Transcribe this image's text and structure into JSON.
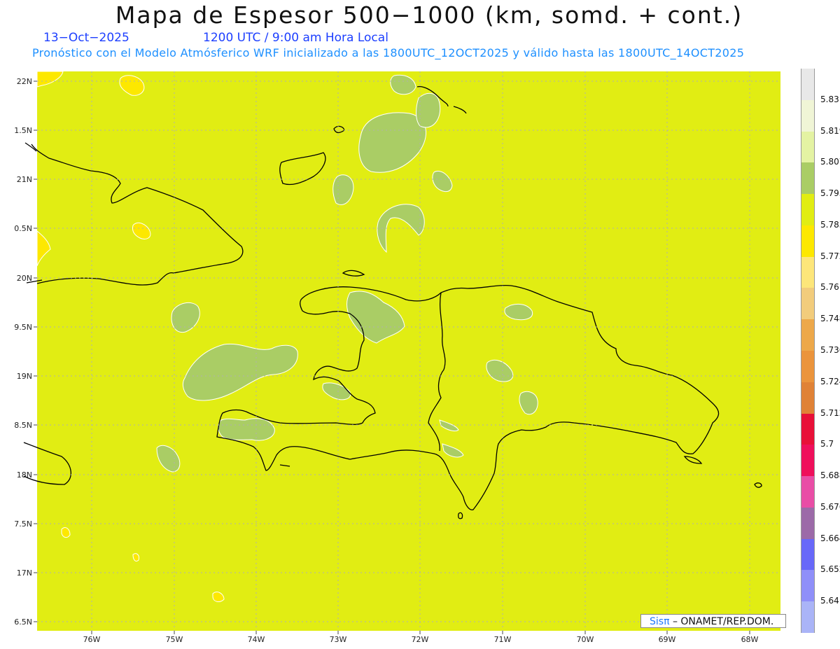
{
  "header": {
    "title": "Mapa de Espesor 500−1000 (km, somd. + cont.)",
    "date": "13−Oct−2025",
    "time": "1200 UTC / 9:00 am Hora Local",
    "forecast": "Pronóstico con el Modelo Atmósferico WRF inicializado a las 1800UTC_12OCT2025 y válido hasta las  1800UTC_14OCT2025"
  },
  "map": {
    "lat_labels": [
      "22N",
      "1.5N",
      "21N",
      "0.5N",
      "20N",
      "9.5N",
      "19N",
      "8.5N",
      "18N",
      "7.5N",
      "17N",
      "6.5N"
    ],
    "lon_labels": [
      "76W",
      "75W",
      "74W",
      "73W",
      "72W",
      "71W",
      "70W",
      "69W",
      "68W"
    ],
    "background_color": "#e1ed13",
    "dominant_band_color": "#e1ed13",
    "secondary_band_color": "#aacd65",
    "low_band_color": "#fde800"
  },
  "colorbar": {
    "levels": [
      "5.831",
      "5.819",
      "5.807",
      "5.795",
      "5.783",
      "5.772",
      "5.76",
      "5.748",
      "5.736",
      "5.724",
      "5.712",
      "5.7",
      "5.688",
      "5.676",
      "5.664",
      "5.652",
      "5.64"
    ],
    "colors": [
      "#e8e8e8",
      "#f0f5d6",
      "#e4f3a3",
      "#aacd65",
      "#e1ed13",
      "#fde800",
      "#fde67a",
      "#f2cc7c",
      "#eda84a",
      "#eb943c",
      "#e08236",
      "#e81038",
      "#ef0f5b",
      "#e94da6",
      "#9c6aa8",
      "#6868f9",
      "#8f8ff9",
      "#aab4f7"
    ]
  },
  "credit": {
    "sis": "Sisπ",
    "org": " – ONAMET/REP.DOM."
  }
}
